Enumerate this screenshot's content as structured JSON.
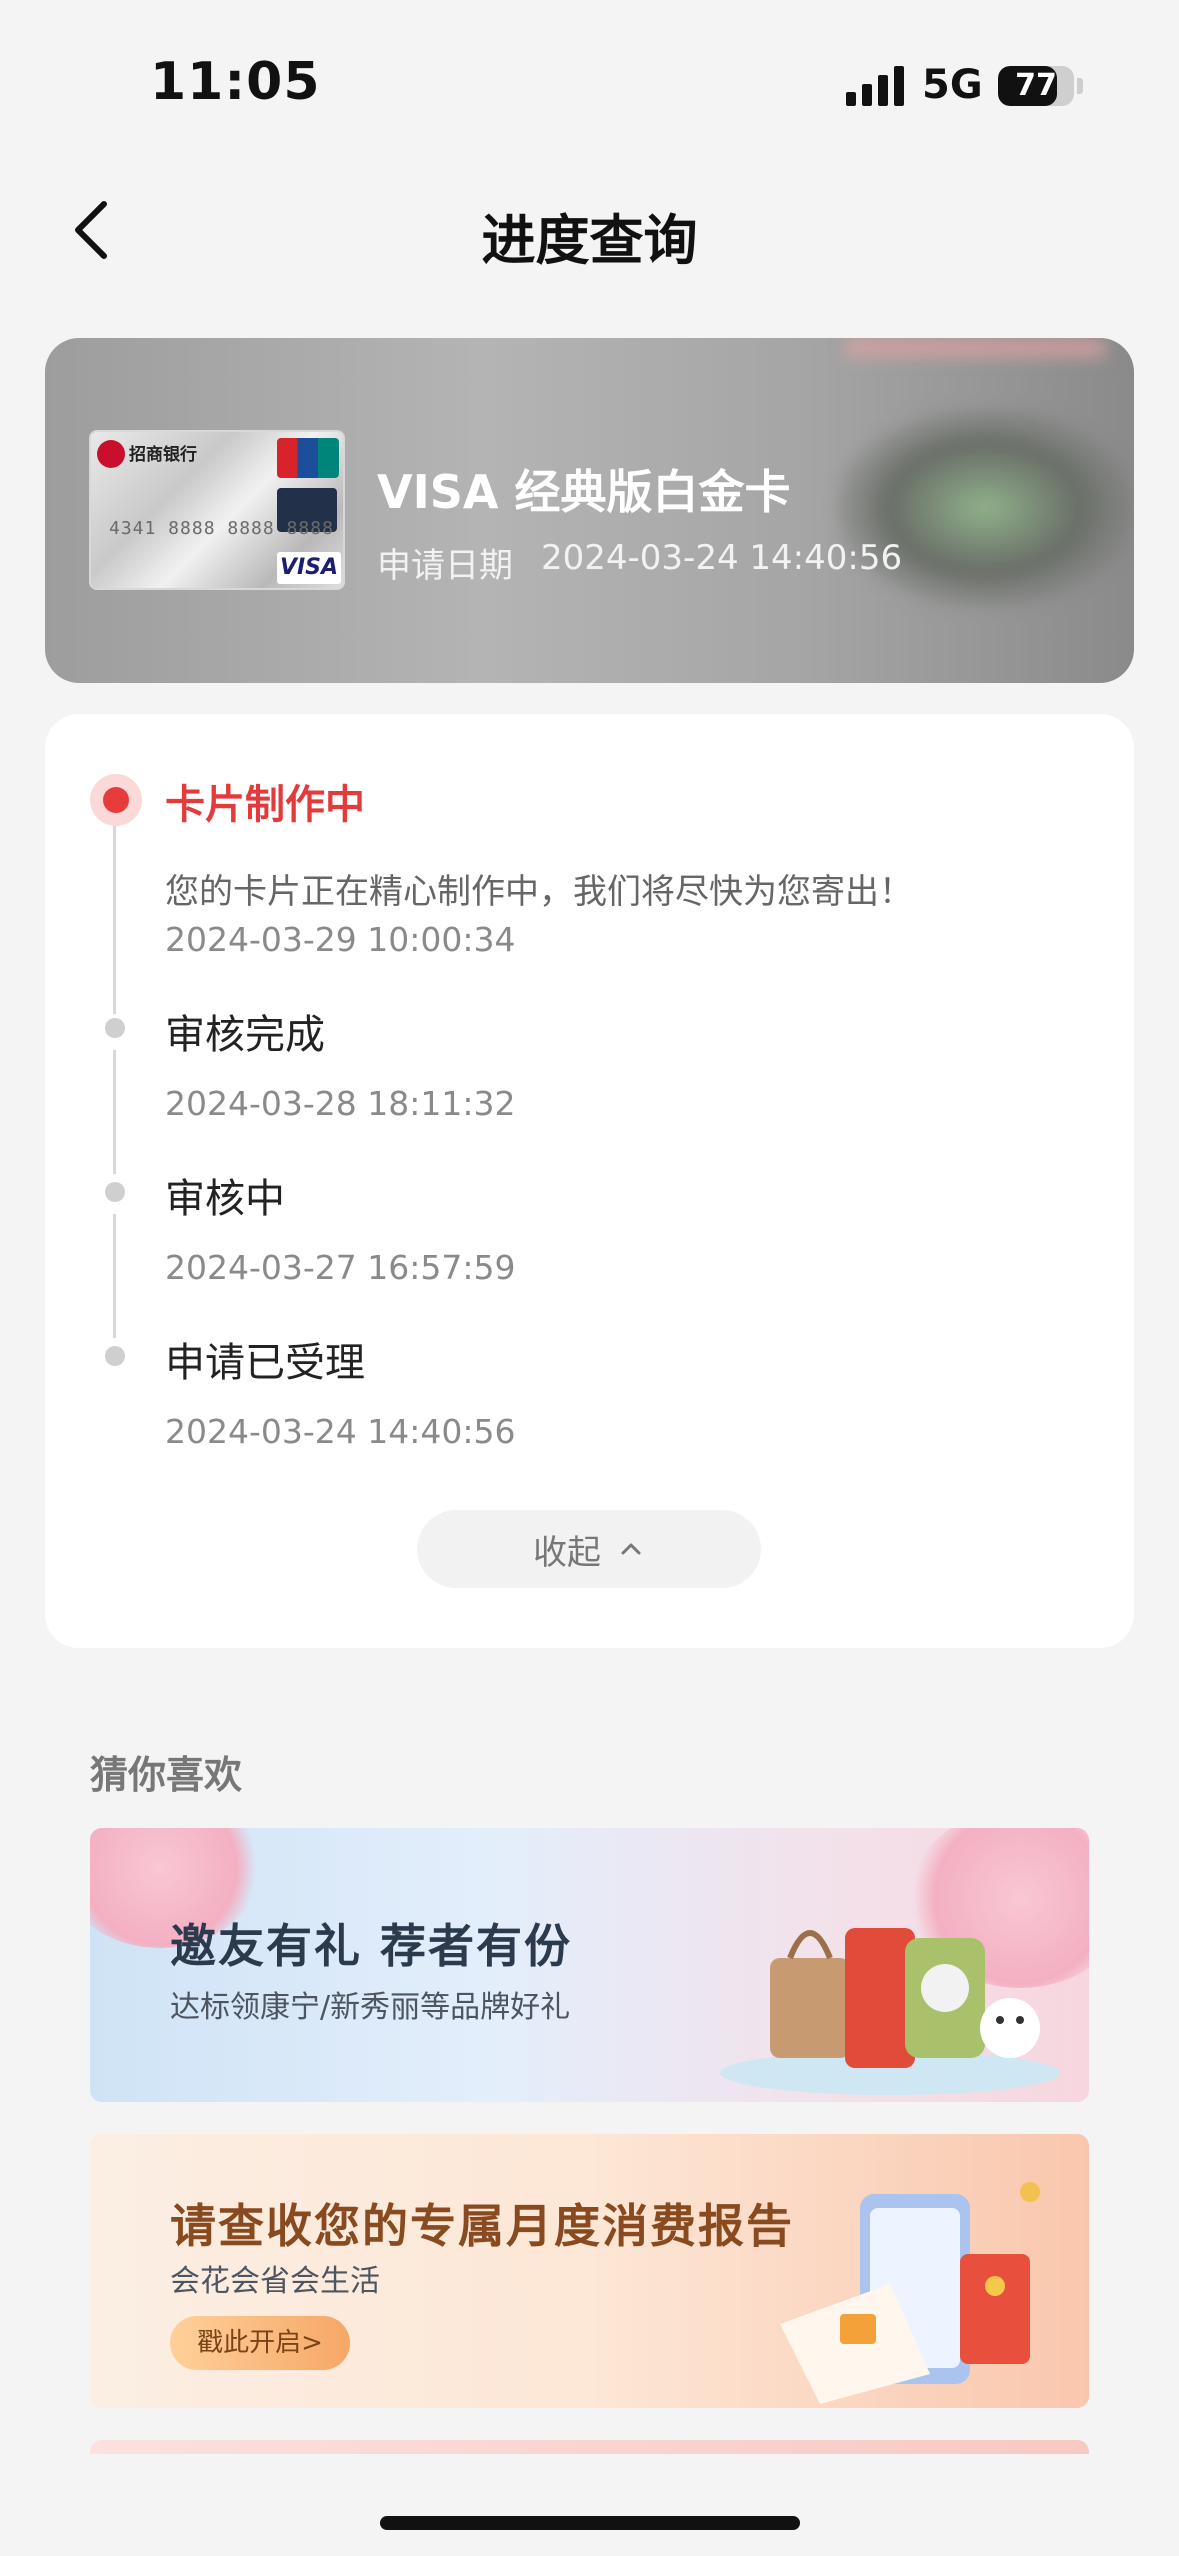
{
  "status_bar": {
    "time": "11:05",
    "network": "5G",
    "battery": "77",
    "battery_level": 0.77
  },
  "nav": {
    "title": "进度查询"
  },
  "card": {
    "name": "VISA 经典版白金卡",
    "apply_label": "申请日期",
    "apply_date": "2024-03-24 14:40:56",
    "image": {
      "bank": "招商银行",
      "number": "4341 8888 8888 8888",
      "brand": "VISA"
    }
  },
  "progress": {
    "steps": [
      {
        "title": "卡片制作中",
        "desc": "您的卡片正在精心制作中，我们将尽快为您寄出！",
        "time": "2024-03-29 10:00:34",
        "active": true
      },
      {
        "title": "审核完成",
        "time": "2024-03-28 18:11:32",
        "active": false
      },
      {
        "title": "审核中",
        "time": "2024-03-27 16:57:59",
        "active": false
      },
      {
        "title": "申请已受理",
        "time": "2024-03-24 14:40:56",
        "active": false
      }
    ],
    "collapse_label": "收起"
  },
  "recommend": {
    "title": "猜你喜欢",
    "banners": [
      {
        "title": "邀友有礼 荐者有份",
        "subtitle": "达标领康宁/新秀丽等品牌好礼",
        "title_color": "#2c3a4e"
      },
      {
        "title": "请查收您的专属月度消费报告",
        "subtitle": "会花会省会生活",
        "cta": "戳此开启>",
        "title_color": "#8a4a1f"
      }
    ]
  },
  "colors": {
    "accent": "#e33b3b",
    "background": "#f4f4f4"
  }
}
